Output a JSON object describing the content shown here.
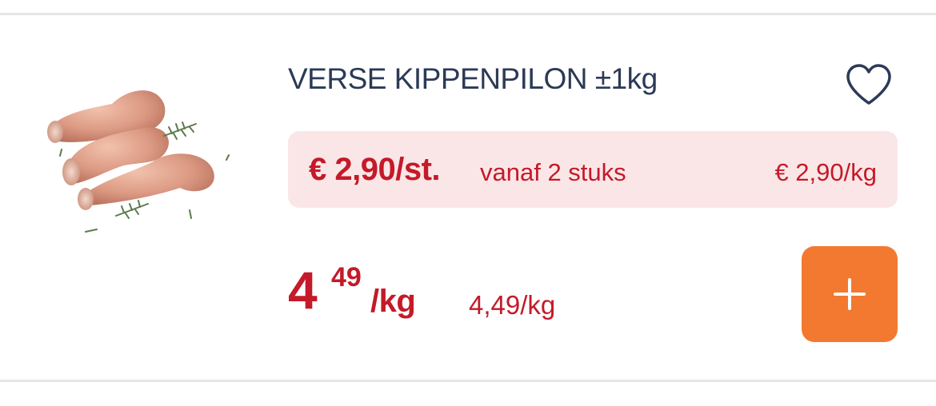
{
  "product": {
    "title": "VERSE KIPPENPILON ±1kg",
    "image_icon": "chicken-drumsticks-image"
  },
  "promo": {
    "price": "€ 2,90/st.",
    "condition": "vanaf 2 stuks",
    "unit_price": "€ 2,90/kg",
    "background_color": "#fbe6e7"
  },
  "price": {
    "integer": "4",
    "decimals": "49",
    "unit": "/kg",
    "unit_price": "4,49/kg"
  },
  "actions": {
    "favorite_icon": "heart-icon",
    "add_icon": "plus-icon"
  },
  "colors": {
    "title": "#2c3a57",
    "price_red": "#c41a29",
    "add_button": "#f2792f",
    "divider": "#e6e6e9"
  }
}
